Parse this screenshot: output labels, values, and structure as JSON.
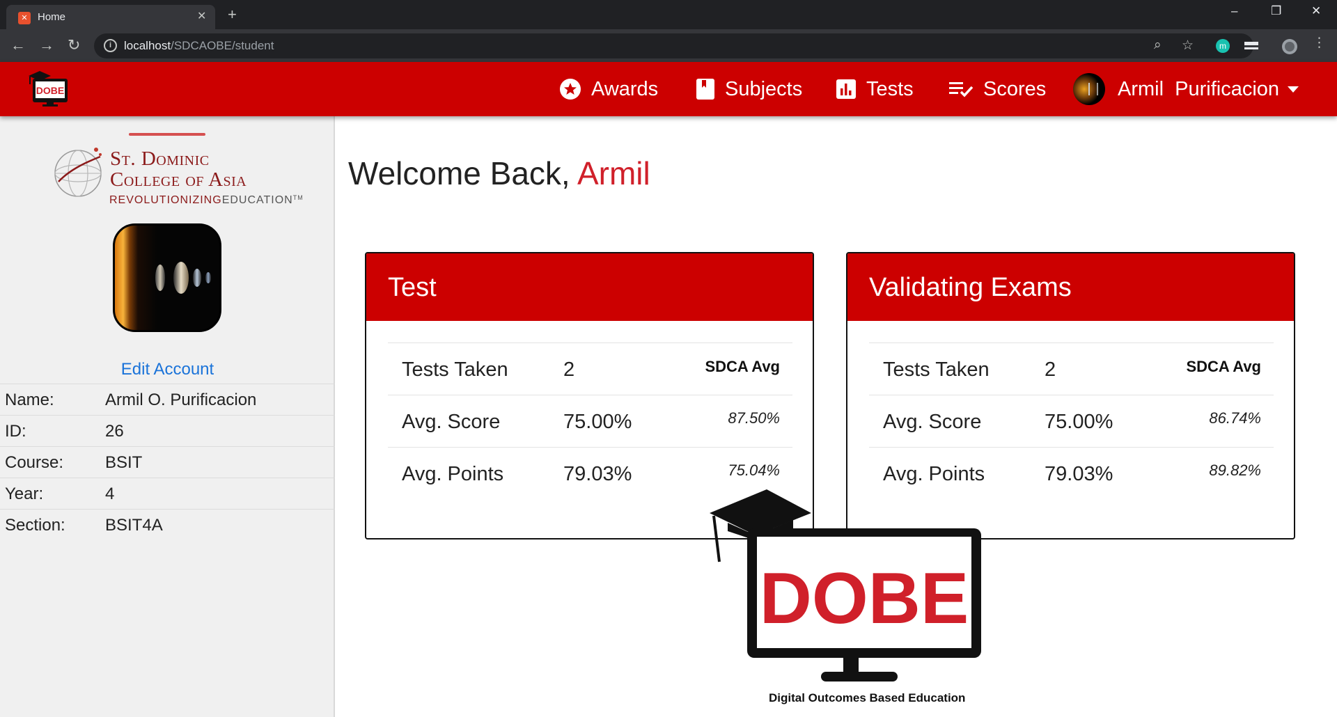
{
  "browser": {
    "tab_title": "Home",
    "url_host": "localhost",
    "url_path": "/SDCAOBE/student"
  },
  "navbar": {
    "logo_text": "DOBE",
    "items": [
      {
        "label": "Awards",
        "icon": "star-icon"
      },
      {
        "label": "Subjects",
        "icon": "book-icon"
      },
      {
        "label": "Tests",
        "icon": "bar-chart-icon"
      },
      {
        "label": "Scores",
        "icon": "checklist-icon"
      }
    ],
    "user_name": "Armil  Purificacion"
  },
  "sidebar": {
    "college_name_line1": "St. Dominic",
    "college_name_line2": "College of Asia",
    "college_tagline_a": "REVOLUTIONIZING",
    "college_tagline_b": "EDUCATION",
    "edit_account": "Edit Account",
    "info": [
      {
        "label": "Name:",
        "value": "Armil O. Purificacion"
      },
      {
        "label": "ID:",
        "value": "26"
      },
      {
        "label": "Course:",
        "value": "BSIT"
      },
      {
        "label": "Year:",
        "value": "4"
      },
      {
        "label": "Section:",
        "value": "BSIT4A"
      }
    ]
  },
  "main": {
    "welcome_prefix": "Welcome Back, ",
    "welcome_name": "Armil",
    "cards": [
      {
        "title": "Test",
        "avg_header": "SDCA Avg",
        "rows": [
          {
            "label": "Tests Taken",
            "value": "2",
            "avg": ""
          },
          {
            "label": "Avg. Score",
            "value": "75.00%",
            "avg": "87.50%"
          },
          {
            "label": "Avg. Points",
            "value": "79.03%",
            "avg": "75.04%"
          }
        ]
      },
      {
        "title": "Validating Exams",
        "avg_header": "SDCA Avg",
        "rows": [
          {
            "label": "Tests Taken",
            "value": "2",
            "avg": ""
          },
          {
            "label": "Avg. Score",
            "value": "75.00%",
            "avg": "86.74%"
          },
          {
            "label": "Avg. Points",
            "value": "79.03%",
            "avg": "89.82%"
          }
        ]
      }
    ],
    "brand_logo_text": "DOBE",
    "brand_caption": "Digital Outcomes Based Education"
  },
  "colors": {
    "brand_red": "#cc0000",
    "accent_red": "#d0202a",
    "link_blue": "#1a73d9"
  }
}
